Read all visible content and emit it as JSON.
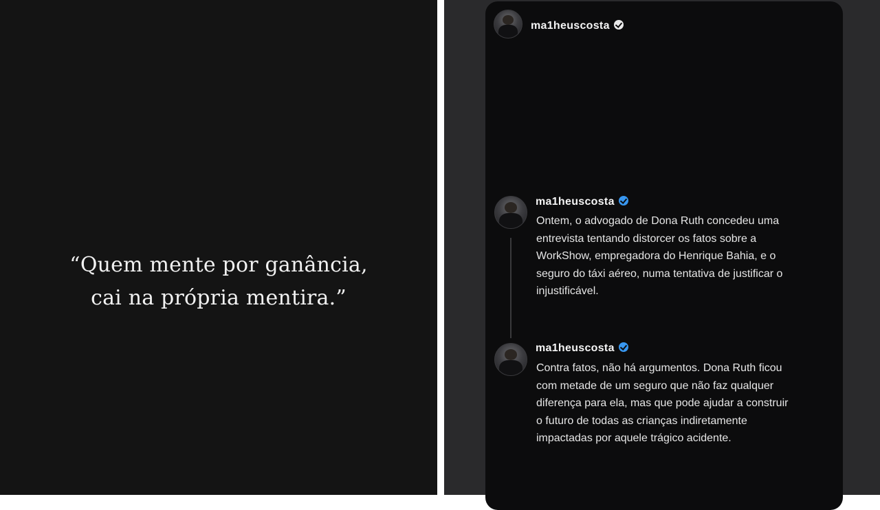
{
  "quote": {
    "lines": [
      "“Quem mente por ganância,",
      "cai na própria mentira.”"
    ]
  },
  "post": {
    "username": "ma1heuscosta"
  },
  "comments": [
    {
      "username": "ma1heuscosta",
      "lines": [
        "Ontem, o advogado de Dona Ruth concedeu uma",
        "entrevista tentando distorcer os fatos sobre a",
        "WorkShow, empregadora do Henrique Bahia, e o",
        "seguro do táxi aéreo, numa tentativa de justificar o",
        "injustificável."
      ]
    },
    {
      "username": "ma1heuscosta",
      "lines": [
        "Contra fatos, não há argumentos. Dona Ruth ficou",
        "com metade de um seguro que não faz qualquer",
        "diferença para ela, mas que pode ajudar a construir",
        "o futuro de todas as crianças indiretamente",
        "impactadas por aquele trágico acidente."
      ]
    }
  ],
  "icons": {
    "verified_badge": "verified-badge-icon"
  },
  "colors": {
    "left_background": "#141414",
    "post_background": "#0c0c0d",
    "verified_blue": "#3897f0"
  }
}
